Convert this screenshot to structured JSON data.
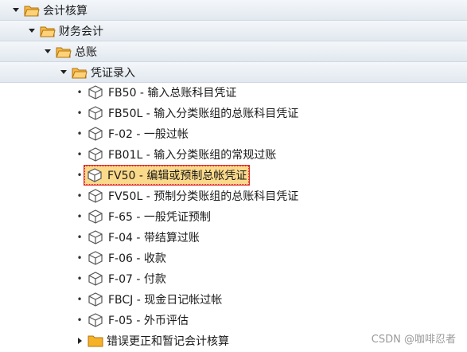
{
  "tree": {
    "level0": {
      "label": "会计核算"
    },
    "level1": {
      "label": "财务会计"
    },
    "level2": {
      "label": "总账"
    },
    "level3": {
      "label": "凭证录入"
    },
    "items": [
      {
        "label": "FB50 - 输入总账科目凭证"
      },
      {
        "label": "FB50L - 输入分类账组的总账科目凭证"
      },
      {
        "label": "F-02 - 一般过帐"
      },
      {
        "label": "FB01L - 输入分类账组的常规过账"
      },
      {
        "label": "FV50 - 编辑或预制总帐凭证",
        "selected": true
      },
      {
        "label": "FV50L - 预制分类账组的总账科目凭证"
      },
      {
        "label": "F-65 - 一般凭证预制"
      },
      {
        "label": "F-04 - 带结算过账"
      },
      {
        "label": "F-06 - 收款"
      },
      {
        "label": "F-07 - 付款"
      },
      {
        "label": "FBCJ - 现金日记帐过帐"
      },
      {
        "label": "F-05 - 外币评估"
      }
    ],
    "bottom_folder": {
      "label": "错误更正和暂记会计核算"
    }
  },
  "watermark": "CSDN @咖啡忍者",
  "colors": {
    "folder": "#f0a21c",
    "selection": "#fbd98a",
    "selection_border": "#e0292a"
  }
}
